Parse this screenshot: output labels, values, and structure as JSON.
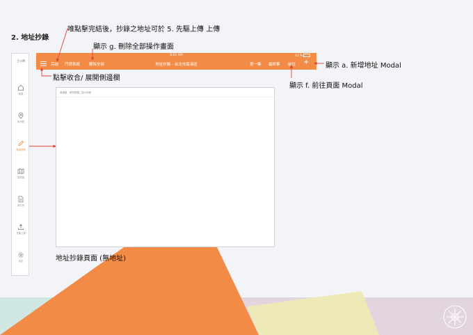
{
  "section_title": "2. 地址抄錄",
  "annotations": {
    "finish_note": "唯點擊完結後，抄錄之地址可於 5. 先驅上傳 上傳",
    "delete_all_note": "顯示 g. 刪除全部操作畫面",
    "add_address_note": "顯示 a. 新增地址 Modal",
    "collapse_note": "點擊收合/ 展開側邊欄",
    "goto_note": "顯示 f. 前往頁面 Modal",
    "page_caption": "地址抄錄頁面 (無地址)"
  },
  "sidebar": {
    "user": "王小明",
    "items": [
      {
        "label": "首頁",
        "icon": "home-icon"
      },
      {
        "label": "街坊點",
        "icon": "location-pin-icon"
      },
      {
        "label": "地址抄錄",
        "icon": "pencil-icon",
        "active": true
      },
      {
        "label": "調查圖",
        "icon": "map-icon"
      },
      {
        "label": "街區資",
        "icon": "document-icon"
      },
      {
        "label": "先驅上傳",
        "icon": "upload-icon"
      },
      {
        "label": "設定",
        "icon": "gear-icon"
      }
    ]
  },
  "topbar": {
    "time": "8:41 AM",
    "battery": "42 %",
    "finish": "完結",
    "door_system": "門牌系統",
    "delete_all": "刪除全部",
    "title": "地址抄錄 - 台北市南港區",
    "first": "第一筆",
    "last": "最終筆",
    "goto": "前往",
    "add": "+"
  },
  "content": {
    "breadcrumb": "南港區 · 研究院路二段128號"
  },
  "colors": {
    "accent": "#f18b45",
    "red_arrow": "#e0413a"
  }
}
